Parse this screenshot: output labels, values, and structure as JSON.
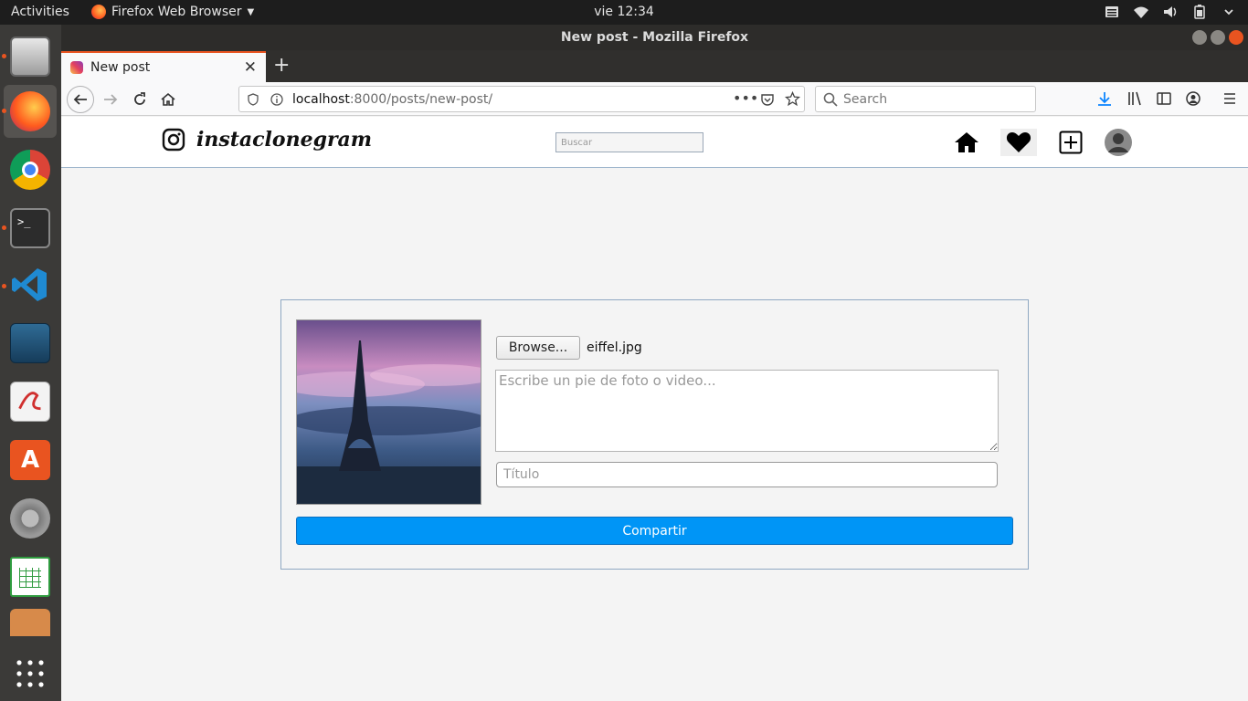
{
  "topbar": {
    "activities": "Activities",
    "app_name": "Firefox Web Browser",
    "clock": "vie 12:34",
    "tray_icons": [
      "menu-icon",
      "wifi-icon",
      "volume-icon",
      "battery-icon",
      "power-menu-icon"
    ]
  },
  "dock": {
    "items": [
      "file-cabinet-icon",
      "firefox-icon",
      "chrome-icon",
      "terminal-icon",
      "vscode-icon",
      "mysql-workbench-icon",
      "pdf-viewer-icon",
      "software-center-icon",
      "system-tools-icon",
      "spreadsheet-icon",
      "printer-icon",
      "app-grid-icon"
    ]
  },
  "window": {
    "title": "New post - Mozilla Firefox",
    "tab_title": "New post",
    "new_tab": "+",
    "tab_close": "✕"
  },
  "navbar": {
    "url_host": "localhost",
    "url_path": ":8000/posts/new-post/",
    "search_placeholder": "Search"
  },
  "site": {
    "brand": "instaclonegram",
    "search_placeholder": "Buscar"
  },
  "form": {
    "browse_label": "Browse...",
    "filename": "eiffel.jpg",
    "caption_placeholder": "Escribe un pie de foto o video...",
    "title_placeholder": "Título",
    "submit_label": "Compartir"
  },
  "colors": {
    "accent": "#e95420",
    "submit": "#0095f6",
    "dock": "#3b3a38",
    "topbar": "#1d1d1d"
  }
}
